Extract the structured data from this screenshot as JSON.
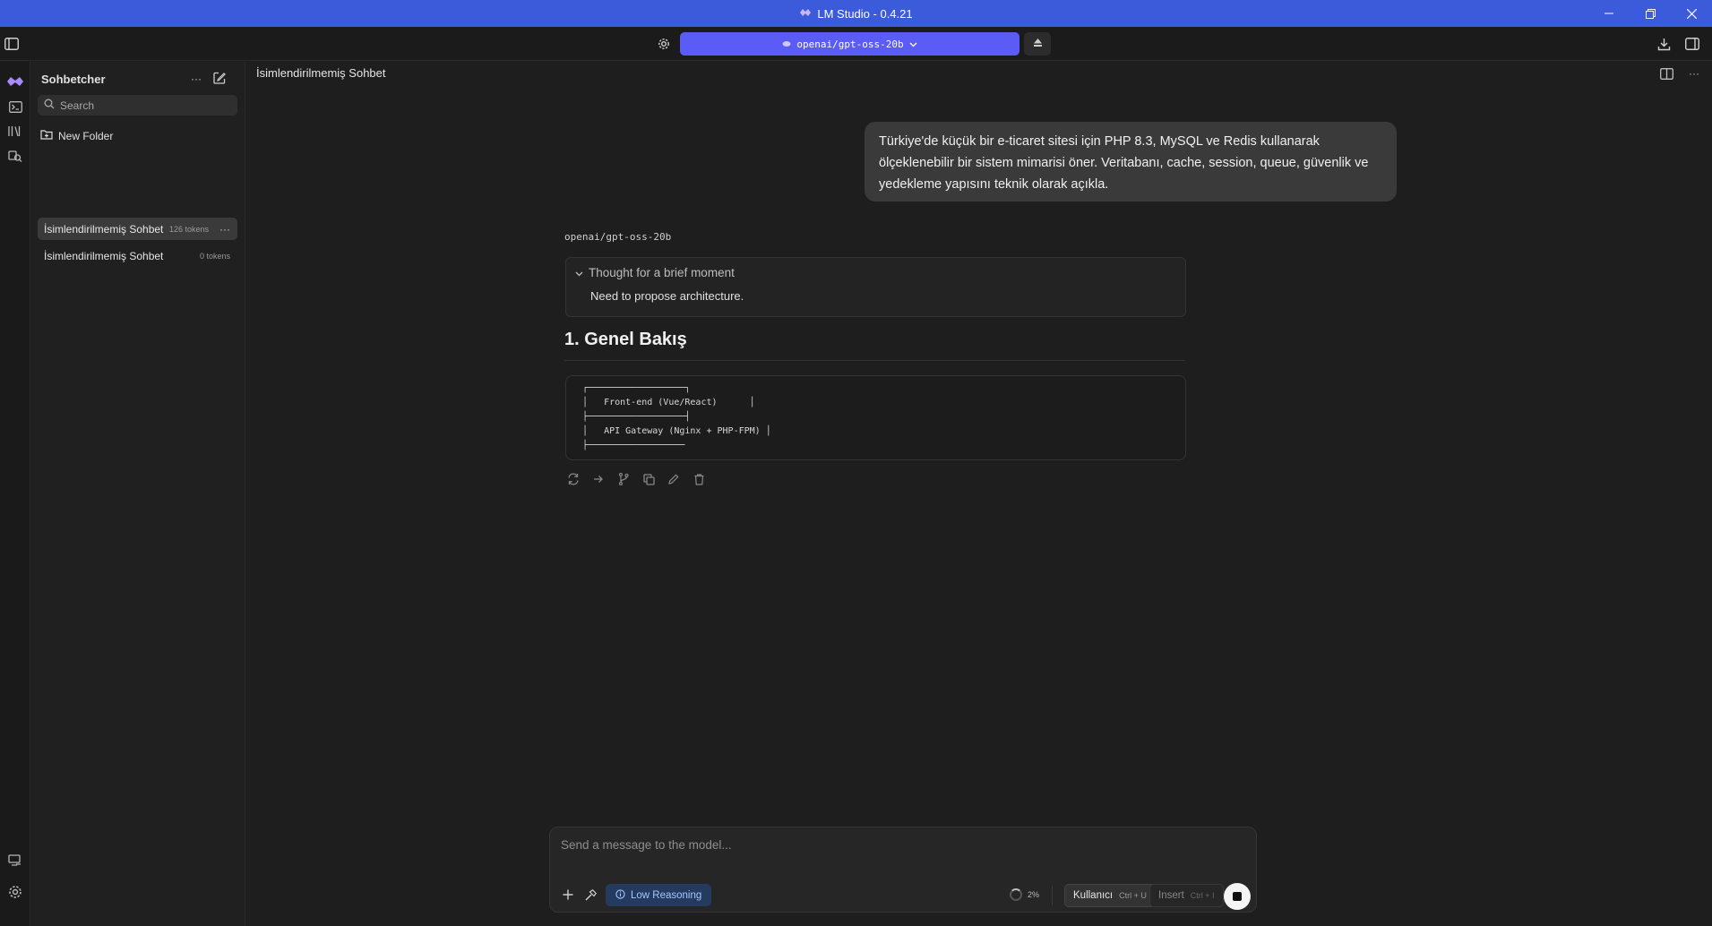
{
  "window": {
    "title": "LM Studio - 0.4.21",
    "minimize": "—",
    "maximize": "❐",
    "close": "✕"
  },
  "toolbar": {
    "model": "openai/gpt-oss-20b"
  },
  "sidebar": {
    "title": "Sohbetcher",
    "search_placeholder": "Search",
    "new_folder": "New Folder",
    "chats": [
      {
        "name": "İsimlendirilmemiş Sohbet",
        "tokens": "126 tokens",
        "active": true
      },
      {
        "name": "İsimlendirilmemiş Sohbet",
        "tokens": "0 tokens",
        "active": false
      }
    ]
  },
  "chat": {
    "title": "İsimlendirilmemiş Sohbet",
    "user_message": "Türkiye'de küçük bir e-ticaret sitesi için PHP 8.3, MySQL ve Redis kullanarak ölçeklenebilir bir sistem mimarisi öner. Veritabanı, cache, session, queue, güvenlik ve yedekleme yapısını teknik olarak açıkla.",
    "model_label": "openai/gpt-oss-20b",
    "thought_header": "Thought for a brief moment",
    "thought_body": "Need to propose architecture.",
    "heading": "1. Genel Bakış",
    "code_lines": [
      "┌──────────────────┐",
      "│   Front-end (Vue/React)      │",
      "├──────────────────┤",
      "│   API Gateway (Nginx + PHP-FPM) │",
      "├──────────────────"
    ]
  },
  "composer": {
    "placeholder": "Send a message to the model...",
    "reasoning": "Low Reasoning",
    "context_pct": "2%",
    "role_label": "Kullanıcı",
    "role_shortcut": "Ctrl + U",
    "insert_label": "Insert",
    "insert_shortcut": "Ctrl + I"
  },
  "colors": {
    "titlebar": "#3b5bdb",
    "model_pill": "#5b5bf5",
    "background": "#1e1e1e"
  }
}
